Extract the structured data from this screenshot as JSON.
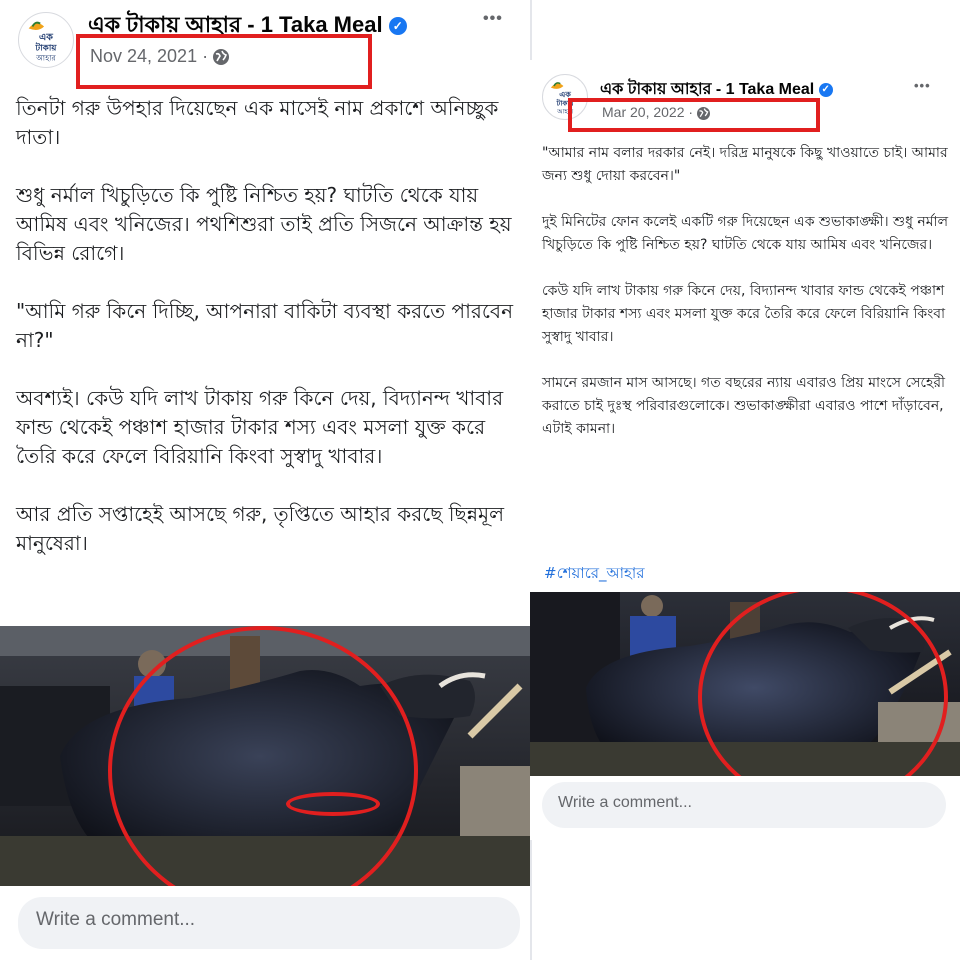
{
  "left_post": {
    "page_name": "এক টাকায় আহার - 1 Taka Meal",
    "date": "Nov 24, 2021",
    "date_separator": "·",
    "avatar_text": "এক টাকায় আহার",
    "more_icon": "•••",
    "verified_icon": "✓",
    "body_text": "তিনটা গরু উপহার দিয়েছেন এক মাসেই নাম প্রকাশে অনিচ্ছুক দাতা।\n\nশুধু নর্মাল খিচুড়িতে কি পুষ্টি নিশ্চিত হয়? ঘাটতি থেকে যায় আমিষ এবং খনিজের। পথশিশুরা তাই প্রতি সিজনে আক্রান্ত হয় বিভিন্ন রোগে।\n\n\"আমি গরু কিনে দিচ্ছি, আপনারা বাকিটা ব্যবস্থা করতে পারবেন না?\"\n\nঅবশ্যই। কেউ যদি লাখ টাকায় গরু কিনে দেয়, বিদ্যানন্দ খাবার ফান্ড থেকেই পঞ্চাশ হাজার টাকার শস্য এবং মসলা যুক্ত করে তৈরি করে ফেলে বিরিয়ানি কিংবা সুস্বাদু খাবার।\n\nআর প্রতি সপ্তাহেই আসছে গরু, তৃপ্তিতে আহার করছে ছিন্নমূল মানুষেরা।",
    "comment_placeholder": "Write a comment..."
  },
  "right_post": {
    "page_name": "এক টাকায় আহার - 1 Taka Meal",
    "date": "Mar 20, 2022",
    "date_separator": "·",
    "avatar_text": "এক টাকায় আহার",
    "more_icon": "•••",
    "verified_icon": "✓",
    "body_text": "\"আমার নাম বলার দরকার নেই। দরিদ্র মানুষকে কিছু খাওয়াতে চাই। আমার জন্য শুধু দোয়া করবেন।\"\n\nদুই মিনিটের ফোন কলেই একটি গরু দিয়েছেন এক শুভাকাঙ্ক্ষী। শুধু নর্মাল খিচুড়িতে কি পুষ্টি নিশ্চিত হয়? ঘাটতি থেকে যায় আমিষ এবং খনিজের।\n\nকেউ যদি লাখ টাকায় গরু কিনে দেয়, বিদ্যানন্দ খাবার ফান্ড থেকেই পঞ্চাশ হাজার টাকার শস্য এবং মসলা যুক্ত করে তৈরি করে ফেলে বিরিয়ানি কিংবা সুস্বাদু খাবার।\n\nসামনে রমজান মাস আসছে। গত বছরের ন্যায় এবারও প্রিয় মাংসে সেহেরী করাতে চাই দুঃস্থ পরিবারগুলোকে। শুভাকাঙ্ক্ষীরা এবারও পাশে দাঁড়াবেন, এটাই কামনা।",
    "hashtag": "#শেয়ারে_আহার",
    "comment_placeholder": "Write a comment..."
  },
  "colors": {
    "highlight_red": "#e11f1f",
    "verified_blue": "#1877f2",
    "hashtag_blue": "#216fdb",
    "meta_gray": "#65676b",
    "comment_bg": "#f0f2f5"
  },
  "icons": [
    "globe-icon",
    "verified-icon",
    "more-options-icon"
  ]
}
